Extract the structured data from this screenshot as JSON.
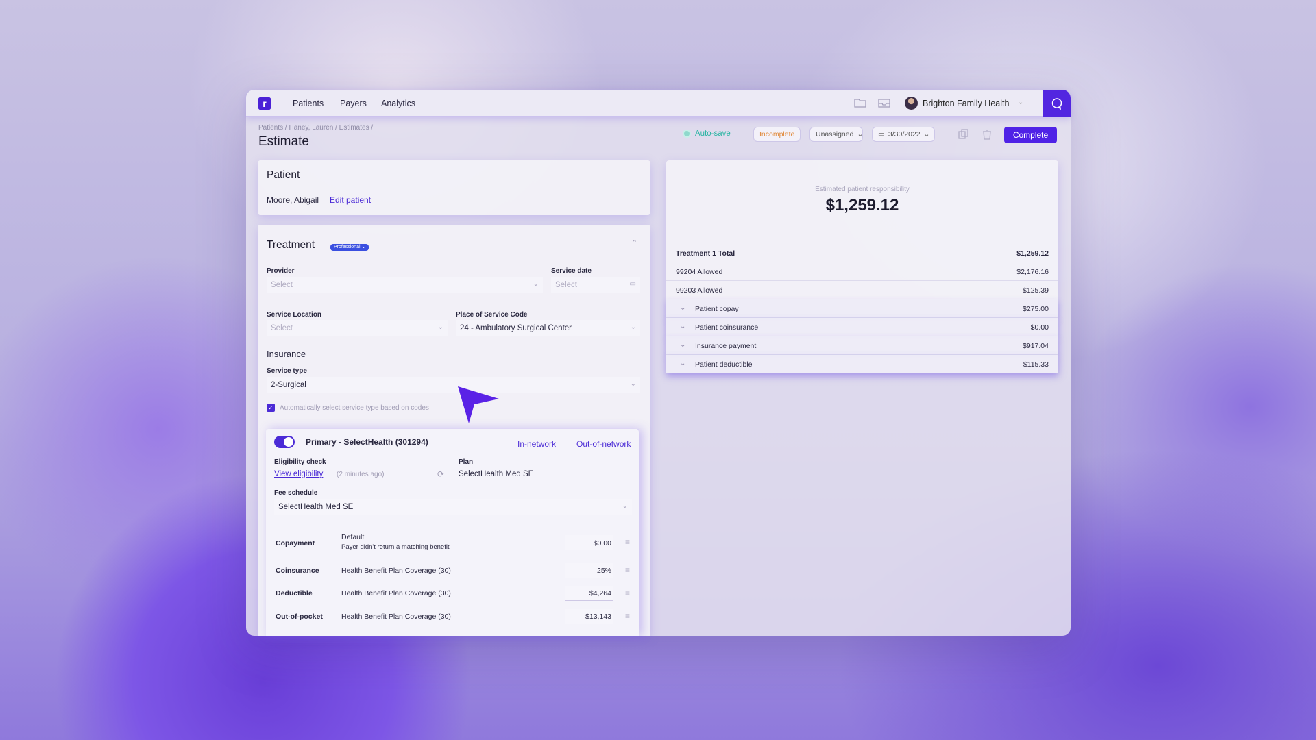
{
  "nav": {
    "logo": "r",
    "links": [
      "Patients",
      "Payers",
      "Analytics"
    ],
    "org_name": "Brighton Family Health"
  },
  "header": {
    "breadcrumb": "Patients / Haney, Lauren / Estimates /",
    "title": "Estimate",
    "autosave": "Auto-save",
    "status": "Incomplete",
    "assignee": "Unassigned",
    "date": "3/30/2022",
    "complete_label": "Complete"
  },
  "patient": {
    "heading": "Patient",
    "name": "Moore, Abigail",
    "edit_label": "Edit patient"
  },
  "treatment": {
    "heading": "Treatment",
    "badge": "Professional ⌄",
    "provider_label": "Provider",
    "provider_placeholder": "Select",
    "service_date_label": "Service date",
    "service_date_placeholder": "Select",
    "service_location_label": "Service Location",
    "service_location_placeholder": "Select",
    "pos_label": "Place of Service Code",
    "pos_value": "24 - Ambulatory Surgical Center",
    "insurance_heading": "Insurance",
    "service_type_label": "Service type",
    "service_type_value": "2-Surgical",
    "auto_select_label": "Automatically select service type based on codes"
  },
  "insurance": {
    "title": "Primary - SelectHealth (301294)",
    "in_network": "In-network",
    "out_network": "Out-of-network",
    "eligibility_label": "Eligibility check",
    "view_eligibility": "View eligibility",
    "eligibility_time": "(2 minutes ago)",
    "plan_label": "Plan",
    "plan_value": "SelectHealth Med SE",
    "fee_schedule_label": "Fee schedule",
    "fee_schedule_value": "SelectHealth Med SE",
    "copay_default": "Default",
    "copay_note": "Payer didn't return a matching benefit",
    "benefits": [
      {
        "name": "Copayment",
        "value": "$0.00"
      },
      {
        "name": "Coinsurance",
        "source": "Health Benefit Plan Coverage (30)",
        "value": "25%"
      },
      {
        "name": "Deductible",
        "source": "Health Benefit Plan Coverage (30)",
        "value": "$4,264"
      },
      {
        "name": "Out-of-pocket",
        "source": "Health Benefit Plan Coverage (30)",
        "value": "$13,143"
      }
    ]
  },
  "summary": {
    "resp_label": "Estimated patient responsibility",
    "resp_total": "$1,259.12",
    "rows": [
      {
        "label": "Treatment 1 Total",
        "value": "$1,259.12"
      },
      {
        "label": "99204 Allowed",
        "value": "$2,176.16"
      },
      {
        "label": "99203 Allowed",
        "value": "$125.39"
      },
      {
        "label": "Patient copay",
        "value": "$275.00"
      },
      {
        "label": "Patient coinsurance",
        "value": "$0.00"
      },
      {
        "label": "Insurance payment",
        "value": "$917.04"
      },
      {
        "label": "Patient deductible",
        "value": "$115.33"
      }
    ]
  },
  "colors": {
    "accent": "#4f22e6",
    "autosave": "#2bb5a3",
    "incomplete": "#e08a3c"
  }
}
